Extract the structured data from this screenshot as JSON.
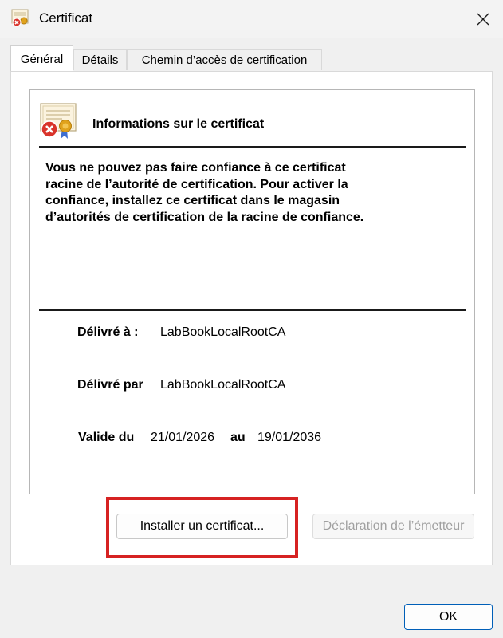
{
  "window": {
    "title": "Certificat",
    "close_icon": "close-icon"
  },
  "tabs": [
    {
      "label": "Général",
      "active": true
    },
    {
      "label": "Détails",
      "active": false
    },
    {
      "label": "Chemin d’accès de certification",
      "active": false
    }
  ],
  "info": {
    "heading": "Informations sur le certificat",
    "warning": "Vous ne pouvez pas faire confiance à ce certificat\nracine de l’autorité de certification. Pour activer la\nconfiance, installez ce certificat dans le magasin\nd’autorités de certification de la racine de confiance.",
    "issued_to_label": "Délivré à :",
    "issued_to_value": "LabBookLocalRootCA",
    "issued_by_label": "Délivré par",
    "issued_by_value": "LabBookLocalRootCA",
    "valid_from_label": "Valide du",
    "valid_from_value": "21/01/2026",
    "valid_to_label": "au",
    "valid_to_value": "19/01/2036"
  },
  "buttons": {
    "install": "Installer un certificat...",
    "issuer_statement": "Déclaration de l’émetteur",
    "ok": "OK"
  },
  "colors": {
    "highlight": "#d62222",
    "accent": "#005fb8",
    "error": "#d9342b",
    "seal": "#e0a21c"
  }
}
